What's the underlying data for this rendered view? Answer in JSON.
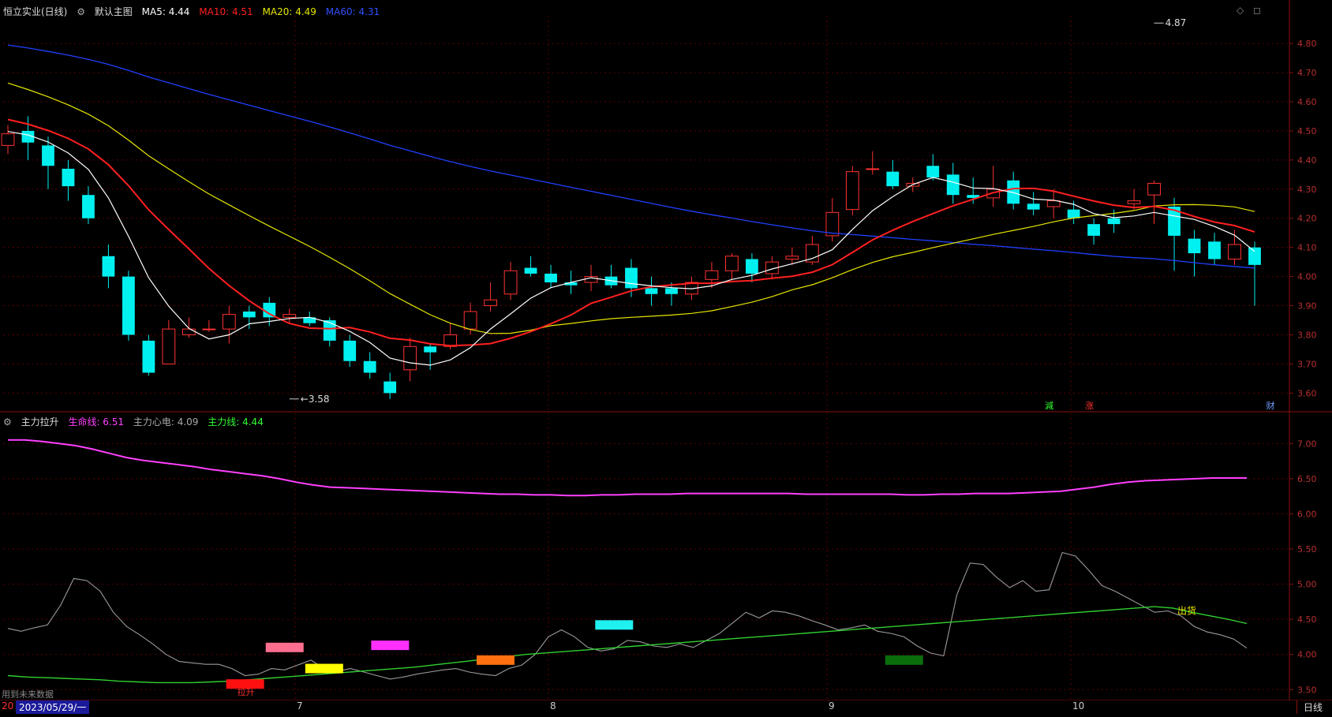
{
  "header": {
    "stock_title": "恒立实业(日线)",
    "main_chart_label": "默认主图",
    "ma_values": [
      {
        "label": "MA5: 4.44",
        "color": "#ffffff"
      },
      {
        "label": "MA10: 4.51",
        "color": "#ff2020"
      },
      {
        "label": "MA20: 4.49",
        "color": "#e6e600"
      },
      {
        "label": "MA60: 4.31",
        "color": "#3050ff"
      }
    ]
  },
  "sub_header": {
    "indicator_title": "主力拉升",
    "values": [
      {
        "label": "生命线: 6.51",
        "color": "#ff40ff"
      },
      {
        "label": "主力心电: 4.09",
        "color": "#aaaaaa"
      },
      {
        "label": "主力线: 4.44",
        "color": "#30ff30"
      }
    ]
  },
  "footer": {
    "date_label": "2023/05/29/一",
    "year_prefix": "20",
    "month_labels": [
      "7",
      "8",
      "9",
      "10"
    ],
    "period_tab": "日线",
    "future_data_note": "用到未来数据"
  },
  "main_chart": {
    "y_ticks": [
      4.8,
      4.7,
      4.6,
      4.5,
      4.4,
      4.3,
      4.2,
      4.1,
      4.0,
      3.9,
      3.8,
      3.7,
      3.6
    ],
    "ylim": [
      3.555,
      4.895
    ],
    "max_annotation": {
      "index": 57,
      "value": 4.87,
      "label": "4.87"
    },
    "min_annotation": {
      "index": 14,
      "value": 3.58,
      "label": "3.58"
    },
    "event_markers": [
      {
        "index": 51,
        "label": "減",
        "color": "#30ff30"
      },
      {
        "index": 53,
        "label": "涨",
        "color": "#ff3030"
      },
      {
        "index": 62,
        "label": "财",
        "color": "#6f9fff"
      }
    ],
    "candles": [
      [
        4.45,
        4.49,
        4.52,
        4.42
      ],
      [
        4.5,
        4.46,
        4.55,
        4.4
      ],
      [
        4.45,
        4.38,
        4.48,
        4.3
      ],
      [
        4.37,
        4.31,
        4.4,
        4.26
      ],
      [
        4.28,
        4.2,
        4.31,
        4.18
      ],
      [
        4.07,
        4.0,
        4.11,
        3.96
      ],
      [
        4.0,
        3.8,
        4.02,
        3.78
      ],
      [
        3.78,
        3.67,
        3.8,
        3.66
      ],
      [
        3.7,
        3.82,
        3.85,
        3.7
      ],
      [
        3.8,
        3.82,
        3.86,
        3.79
      ],
      [
        3.82,
        3.82,
        3.85,
        3.81
      ],
      [
        3.82,
        3.87,
        3.9,
        3.77
      ],
      [
        3.88,
        3.86,
        3.9,
        3.82
      ],
      [
        3.91,
        3.86,
        3.93,
        3.83
      ],
      [
        3.86,
        3.87,
        3.89,
        3.84
      ],
      [
        3.86,
        3.84,
        3.88,
        3.83
      ],
      [
        3.85,
        3.78,
        3.86,
        3.76
      ],
      [
        3.78,
        3.71,
        3.8,
        3.69
      ],
      [
        3.71,
        3.67,
        3.74,
        3.65
      ],
      [
        3.64,
        3.6,
        3.67,
        3.58
      ],
      [
        3.68,
        3.76,
        3.79,
        3.64
      ],
      [
        3.76,
        3.74,
        3.77,
        3.68
      ],
      [
        3.76,
        3.8,
        3.84,
        3.75
      ],
      [
        3.82,
        3.88,
        3.91,
        3.8
      ],
      [
        3.9,
        3.92,
        3.98,
        3.88
      ],
      [
        3.94,
        4.02,
        4.05,
        3.92
      ],
      [
        4.03,
        4.01,
        4.07,
        4.0
      ],
      [
        4.01,
        3.98,
        4.04,
        3.96
      ],
      [
        3.98,
        3.97,
        4.02,
        3.94
      ],
      [
        3.98,
        4.0,
        4.04,
        3.95
      ],
      [
        4.0,
        3.97,
        4.04,
        3.96
      ],
      [
        4.03,
        3.96,
        4.06,
        3.93
      ],
      [
        3.96,
        3.94,
        4.0,
        3.9
      ],
      [
        3.96,
        3.94,
        3.98,
        3.9
      ],
      [
        3.94,
        3.98,
        4.0,
        3.92
      ],
      [
        3.99,
        4.02,
        4.05,
        3.96
      ],
      [
        4.02,
        4.07,
        4.08,
        3.99
      ],
      [
        4.06,
        4.01,
        4.08,
        3.98
      ],
      [
        4.01,
        4.05,
        4.07,
        3.99
      ],
      [
        4.06,
        4.07,
        4.1,
        4.04
      ],
      [
        4.05,
        4.11,
        4.14,
        4.04
      ],
      [
        4.14,
        4.22,
        4.27,
        4.12
      ],
      [
        4.23,
        4.36,
        4.38,
        4.21
      ],
      [
        4.37,
        4.37,
        4.43,
        4.35
      ],
      [
        4.36,
        4.31,
        4.4,
        4.3
      ],
      [
        4.31,
        4.32,
        4.34,
        4.29
      ],
      [
        4.38,
        4.34,
        4.42,
        4.33
      ],
      [
        4.35,
        4.28,
        4.39,
        4.25
      ],
      [
        4.28,
        4.27,
        4.34,
        4.25
      ],
      [
        4.27,
        4.3,
        4.38,
        4.24
      ],
      [
        4.33,
        4.25,
        4.36,
        4.23
      ],
      [
        4.25,
        4.23,
        4.29,
        4.21
      ],
      [
        4.24,
        4.26,
        4.3,
        4.2
      ],
      [
        4.23,
        4.2,
        4.26,
        4.18
      ],
      [
        4.18,
        4.14,
        4.2,
        4.11
      ],
      [
        4.2,
        4.18,
        4.23,
        4.15
      ],
      [
        4.25,
        4.26,
        4.3,
        4.23
      ],
      [
        4.28,
        4.32,
        4.33,
        4.18
      ],
      [
        4.24,
        4.14,
        4.27,
        4.02
      ],
      [
        4.13,
        4.08,
        4.16,
        4.0
      ],
      [
        4.12,
        4.06,
        4.15,
        4.04
      ],
      [
        4.06,
        4.11,
        4.16,
        4.04
      ],
      [
        4.1,
        4.04,
        4.12,
        3.9
      ]
    ]
  },
  "chart_data": {
    "type": "candlestick",
    "title": "恒立实业(日线)",
    "x_labels": [
      "7",
      "8",
      "9",
      "10"
    ],
    "ylim": [
      3.555,
      4.895
    ],
    "ma_series_latest": {
      "MA5": 4.44,
      "MA10": 4.51,
      "MA20": 4.49,
      "MA60": 4.31
    },
    "sub_chart": {
      "title": "主力拉升",
      "ylim": [
        3.38,
        7.25
      ],
      "y_ticks": [
        7.0,
        6.5,
        6.0,
        5.5,
        5.0,
        4.5,
        4.0,
        3.5
      ],
      "latest": {
        "生命线": 6.51,
        "主力心电": 4.09,
        "主力线": 4.44
      },
      "lifeline": [
        7.05,
        7.05,
        7.03,
        7.0,
        6.97,
        6.92,
        6.86,
        6.8,
        6.76,
        6.73,
        6.7,
        6.67,
        6.63,
        6.6,
        6.57,
        6.54,
        6.5,
        6.45,
        6.41,
        6.38,
        6.37,
        6.36,
        6.35,
        6.34,
        6.33,
        6.32,
        6.31,
        6.3,
        6.29,
        6.28,
        6.28,
        6.27,
        6.27,
        6.26,
        6.26,
        6.27,
        6.27,
        6.28,
        6.28,
        6.28,
        6.29,
        6.29,
        6.29,
        6.29,
        6.29,
        6.29,
        6.29,
        6.28,
        6.28,
        6.28,
        6.28,
        6.28,
        6.28,
        6.27,
        6.27,
        6.28,
        6.28,
        6.29,
        6.29,
        6.29,
        6.3,
        6.31,
        6.32,
        6.35,
        6.38,
        6.42,
        6.45,
        6.47,
        6.48,
        6.49,
        6.5,
        6.51,
        6.51,
        6.51
      ],
      "heartbeat": [
        4.37,
        4.33,
        4.38,
        4.42,
        4.7,
        5.08,
        5.05,
        4.9,
        4.6,
        4.4,
        4.28,
        4.15,
        4.0,
        3.9,
        3.88,
        3.86,
        3.86,
        3.8,
        3.7,
        3.72,
        3.8,
        3.78,
        3.85,
        3.92,
        3.8,
        3.76,
        3.8,
        3.75,
        3.7,
        3.65,
        3.68,
        3.72,
        3.75,
        3.78,
        3.8,
        3.75,
        3.72,
        3.7,
        3.8,
        3.85,
        4.0,
        4.25,
        4.35,
        4.25,
        4.1,
        4.05,
        4.08,
        4.2,
        4.18,
        4.12,
        4.1,
        4.15,
        4.1,
        4.2,
        4.3,
        4.45,
        4.6,
        4.52,
        4.62,
        4.6,
        4.55,
        4.48,
        4.42,
        4.35,
        4.38,
        4.42,
        4.33,
        4.3,
        4.25,
        4.12,
        4.02,
        3.98,
        4.85,
        5.3,
        5.28,
        5.1,
        4.95,
        5.05,
        4.9,
        4.92,
        5.45,
        5.4,
        5.2,
        4.98,
        4.9,
        4.8,
        4.7,
        4.6,
        4.62,
        4.55,
        4.4,
        4.32,
        4.28,
        4.22,
        4.09
      ],
      "mainline": [
        3.7,
        3.68,
        3.67,
        3.66,
        3.65,
        3.64,
        3.62,
        3.61,
        3.6,
        3.6,
        3.6,
        3.61,
        3.62,
        3.64,
        3.66,
        3.68,
        3.7,
        3.72,
        3.74,
        3.76,
        3.78,
        3.8,
        3.82,
        3.85,
        3.88,
        3.91,
        3.94,
        3.97,
        4.0,
        4.02,
        4.04,
        4.06,
        4.08,
        4.1,
        4.12,
        4.14,
        4.16,
        4.18,
        4.2,
        4.22,
        4.24,
        4.26,
        4.28,
        4.3,
        4.32,
        4.34,
        4.36,
        4.38,
        4.4,
        4.42,
        4.44,
        4.46,
        4.48,
        4.5,
        4.52,
        4.54,
        4.56,
        4.58,
        4.6,
        4.62,
        4.64,
        4.66,
        4.68,
        4.66,
        4.6,
        4.55,
        4.5,
        4.44
      ],
      "signal_bars": [
        {
          "x_index": 18,
          "value": 3.58,
          "color": "#ff1010",
          "label": "拉升"
        },
        {
          "x_index": 21,
          "value": 4.1,
          "color": "#ff6e8e"
        },
        {
          "x_index": 24,
          "value": 3.8,
          "color": "#ffff00"
        },
        {
          "x_index": 29,
          "value": 4.13,
          "color": "#ff30ff"
        },
        {
          "x_index": 37,
          "value": 3.92,
          "color": "#ff7010"
        },
        {
          "x_index": 46,
          "value": 4.42,
          "color": "#20f0f0"
        },
        {
          "x_index": 68,
          "value": 3.92,
          "color": "#0b6e0b"
        }
      ],
      "sell_label": {
        "text": "出货",
        "color": "#e6e600"
      }
    }
  },
  "colors": {
    "up": "#ff3232",
    "down": "#00f0f0",
    "grid": "#5a0000",
    "axis": "#8c1010",
    "ma5": "#ffffff",
    "ma10": "#ff2020",
    "ma20": "#e6e600",
    "ma60": "#2040ff"
  }
}
